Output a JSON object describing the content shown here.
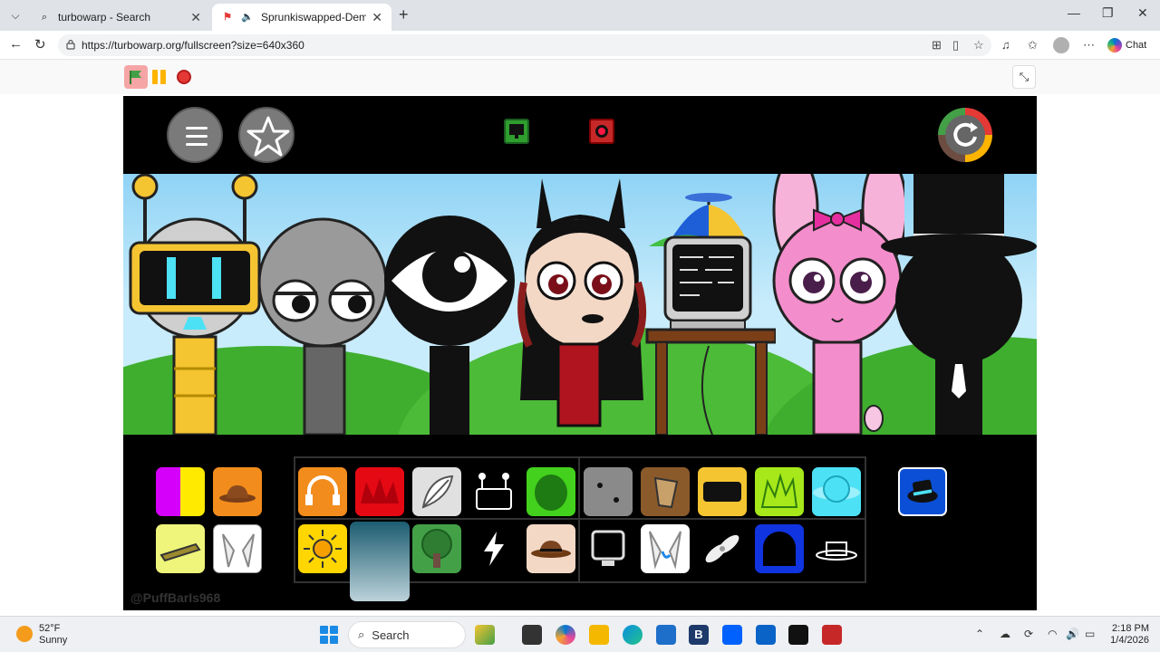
{
  "browser": {
    "tabs": [
      {
        "title": "turbowarp - Search",
        "icon": "search-icon"
      },
      {
        "title": "Sprunkiswapped-Demons gre",
        "icon": "turbowarp-icon",
        "active": true
      }
    ],
    "url": "https://turbowarp.org/fullscreen?size=640x360",
    "chat_label": "Chat"
  },
  "project": {
    "handle": "@PuffBarIs968"
  },
  "colors": {
    "stage_bg": "#000000",
    "sky": "#8fd3f5",
    "grass": "#3fae2f",
    "accent_orange": "#f28c1c",
    "accent_blue": "#1e88e5"
  },
  "taskbar": {
    "temp": "52°F",
    "condition": "Sunny",
    "search_label": "Search",
    "time": "2:18 PM",
    "date": "1/4/2026"
  }
}
